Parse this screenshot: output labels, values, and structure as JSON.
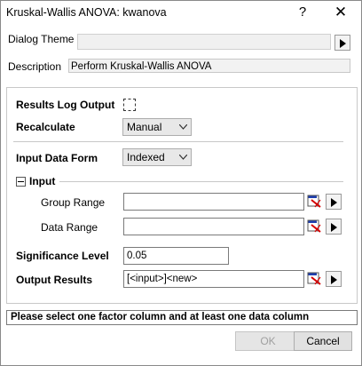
{
  "window": {
    "title": "Kruskal-Wallis ANOVA: kwanova",
    "help_glyph": "?",
    "close_glyph": "✕"
  },
  "theme": {
    "label": "Dialog Theme",
    "value": ""
  },
  "description": {
    "label": "Description",
    "value": "Perform Kruskal-Wallis ANOVA"
  },
  "results_log": {
    "label": "Results Log Output",
    "checked": false
  },
  "recalculate": {
    "label": "Recalculate",
    "value": "Manual"
  },
  "input_data_form": {
    "label": "Input Data Form",
    "value": "Indexed"
  },
  "input_group": {
    "label": "Input",
    "group_range": {
      "label": "Group Range",
      "value": ""
    },
    "data_range": {
      "label": "Data Range",
      "value": ""
    }
  },
  "significance": {
    "label": "Significance Level",
    "value": "0.05"
  },
  "output": {
    "label": "Output Results",
    "value": "[<input>]<new>"
  },
  "status": {
    "message": "Please select one factor column and at least one data column"
  },
  "buttons": {
    "ok": "OK",
    "cancel": "Cancel",
    "ok_enabled": false
  },
  "colors": {
    "pick_red": "#d40000",
    "pick_blue": "#1f3fb0"
  }
}
